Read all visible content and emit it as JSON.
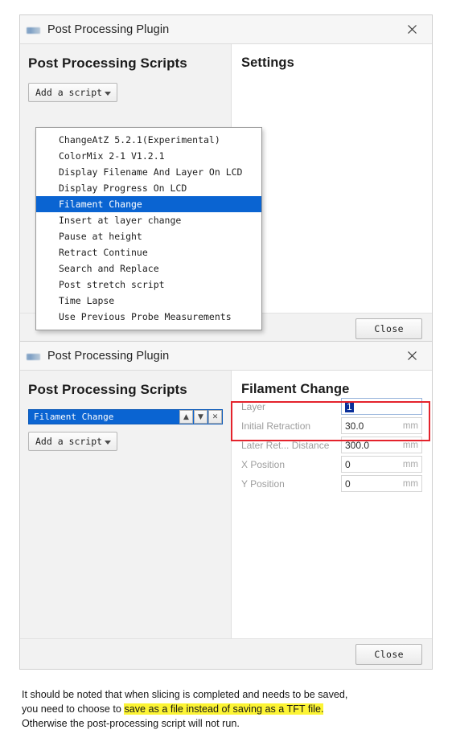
{
  "dialog1": {
    "titlebar": {
      "title": "Post Processing Plugin",
      "close_icon": "close-icon"
    },
    "left": {
      "heading": "Post Processing Scripts",
      "add_script_label": "Add a script"
    },
    "dropdown": {
      "items": [
        "ChangeAtZ 5.2.1(Experimental)",
        "ColorMix 2-1 V1.2.1",
        "Display Filename And Layer On LCD",
        "Display Progress On LCD",
        "Filament Change",
        "Insert at layer change",
        "Pause at height",
        "Retract Continue",
        "Search and Replace",
        "Post stretch script",
        "Time Lapse",
        "Use Previous Probe Measurements"
      ],
      "selected_index": 4
    },
    "right": {
      "heading": "Settings"
    },
    "footer": {
      "close_label": "Close"
    }
  },
  "dialog2": {
    "titlebar": {
      "title": "Post Processing Plugin",
      "close_icon": "close-icon"
    },
    "left": {
      "heading": "Post Processing Scripts",
      "add_script_label": "Add a script",
      "script_item": {
        "label": "Filament Change",
        "move_up_icon": "chevron-up-icon",
        "move_down_icon": "chevron-down-icon",
        "remove_icon": "close-icon"
      }
    },
    "right": {
      "heading": "Filament Change",
      "fields": [
        {
          "label": "Layer",
          "value": "1",
          "unit": "",
          "focused": true
        },
        {
          "label": "Initial Retraction",
          "value": "30.0",
          "unit": "mm",
          "focused": false
        },
        {
          "label": "Later Ret... Distance",
          "value": "300.0",
          "unit": "mm",
          "focused": false
        },
        {
          "label": "X Position",
          "value": "0",
          "unit": "mm",
          "focused": false
        },
        {
          "label": "Y Position",
          "value": "0",
          "unit": "mm",
          "focused": false
        }
      ]
    },
    "footer": {
      "close_label": "Close"
    }
  },
  "caption": {
    "line1": "It should be noted that when slicing is completed and needs to be saved,",
    "line2_pre": "you need to choose to ",
    "line2_highlight": "save as a file instead of saving as a TFT file.",
    "line3": "Otherwise the post-processing script will not run."
  },
  "colors": {
    "selection_blue": "#0a64d2",
    "highlight_red": "#e4232c",
    "highlight_yellow": "#fcf434"
  }
}
